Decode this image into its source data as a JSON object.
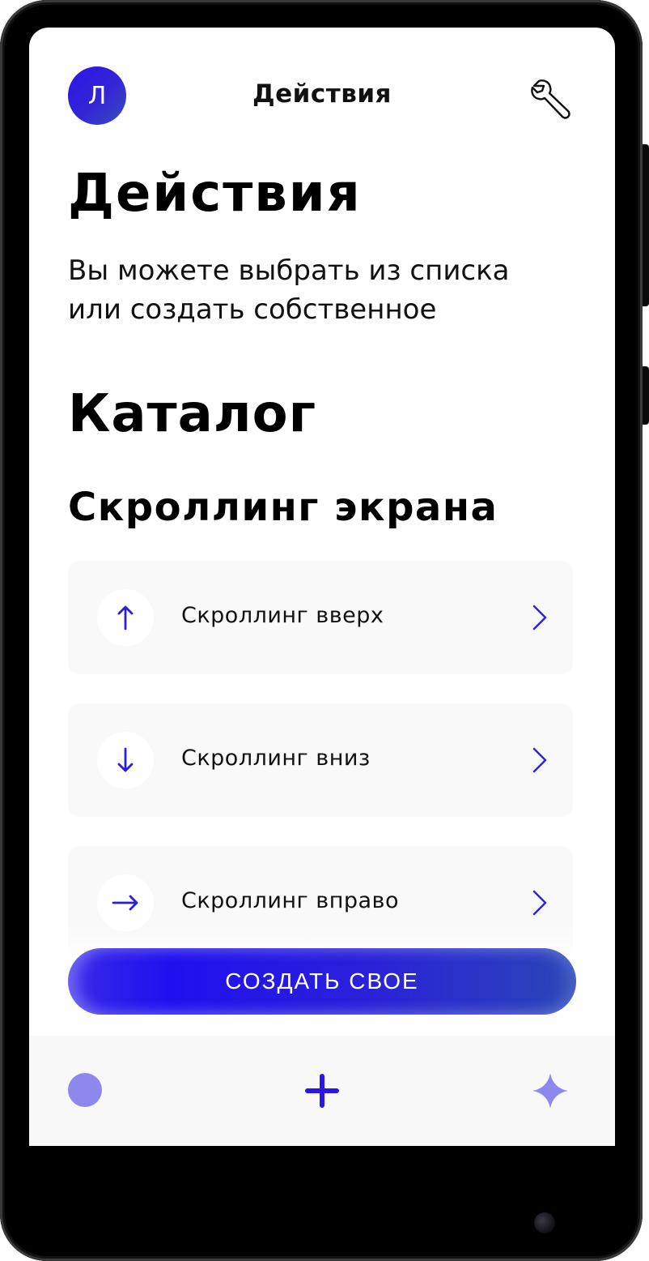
{
  "header": {
    "avatar_initial": "Л",
    "title": "Действия"
  },
  "intro": {
    "heading": "Действия",
    "description": "Вы можете выбрать из списка или создать собственное"
  },
  "catalog": {
    "title": "Каталог",
    "section_title": "Скроллинг экрана",
    "items": [
      {
        "label": "Скроллинг вверх",
        "icon": "arrow-up-icon"
      },
      {
        "label": "Скроллинг вниз",
        "icon": "arrow-down-icon"
      },
      {
        "label": "Скроллинг вправо",
        "icon": "arrow-right-icon"
      }
    ]
  },
  "cta": {
    "label": "СОЗДАТЬ СВОЕ"
  },
  "bottom_nav": {
    "icons": [
      "circle-icon",
      "plus-icon",
      "sparkle-icon"
    ]
  },
  "colors": {
    "accent": "#2b14e6",
    "accent_light": "#8f88ec",
    "card_bg": "#f9f9f9",
    "text": "#111111"
  }
}
